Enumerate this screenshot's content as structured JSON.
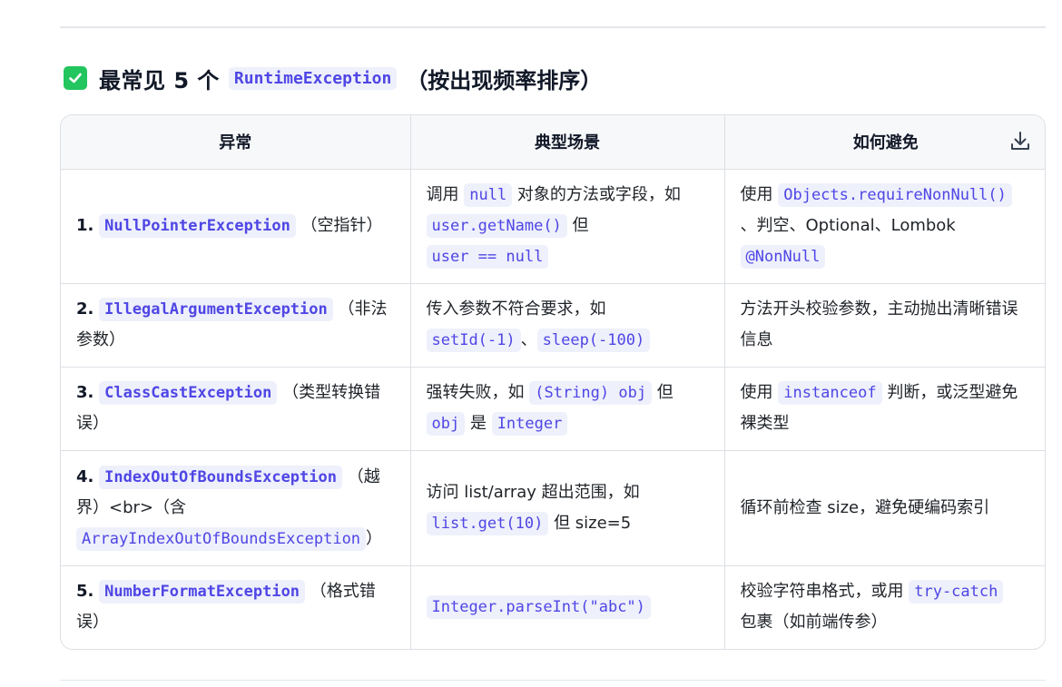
{
  "heading": {
    "prefix": "最常见 5 个",
    "code": "RuntimeException",
    "suffix": "（按出现频率排序）"
  },
  "table": {
    "headers": [
      "异常",
      "典型场景",
      "如何避免"
    ],
    "rows": [
      {
        "num": "1.",
        "exception": "NullPointerException",
        "exception_note": "（空指针）",
        "scenario": {
          "t1": "调用",
          "c1": "null",
          "t2": "对象的方法或字段，如",
          "c2": "user.getName()",
          "t3": "但",
          "c3": "user == null"
        },
        "avoid": {
          "t1": "使用",
          "c1": "Objects.requireNonNull()",
          "t2": "、判空、Optional、Lombok",
          "c2": "@NonNull"
        }
      },
      {
        "num": "2.",
        "exception": "IllegalArgumentException",
        "exception_note": "（非法参数）",
        "scenario": {
          "t1": "传入参数不符合要求，如",
          "c1": "setId(-1)",
          "t2": "、",
          "c2": "sleep(-100)"
        },
        "avoid": {
          "t1": "方法开头校验参数，主动抛出清晰错误信息"
        }
      },
      {
        "num": "3.",
        "exception": "ClassCastException",
        "exception_note": "（类型转换错误）",
        "scenario": {
          "t1": "强转失败，如",
          "c1": "(String) obj",
          "t2": "但",
          "c2": "obj",
          "t3": "是",
          "c3": "Integer"
        },
        "avoid": {
          "t1": "使用",
          "c1": "instanceof",
          "t2": "判断，或泛型避免裸类型"
        }
      },
      {
        "num": "4.",
        "exception": "IndexOutOfBoundsException",
        "exception_note": "（越界）<br>（含",
        "exception_code2": "ArrayIndexOutOfBoundsException",
        "exception_note2": "）",
        "scenario": {
          "t1": "访问 list/array 超出范围，如",
          "c1": "list.get(10)",
          "t2": "但 size=5"
        },
        "avoid": {
          "t1": "循环前检查 size，避免硬编码索引"
        }
      },
      {
        "num": "5.",
        "exception": "NumberFormatException",
        "exception_note": "（格式错误）",
        "scenario": {
          "c1": "Integer.parseInt(\"abc\")"
        },
        "avoid": {
          "t1": "校验字符串格式，或用",
          "c1": "try-catch",
          "t2": "包裹（如前端传参）"
        }
      }
    ]
  },
  "icons": {
    "check": "checkbox-checked-icon",
    "download": "download-icon"
  },
  "colors": {
    "check_green": "#22c55e",
    "code_text": "#4f46e5",
    "code_bg": "#eef0fb"
  }
}
